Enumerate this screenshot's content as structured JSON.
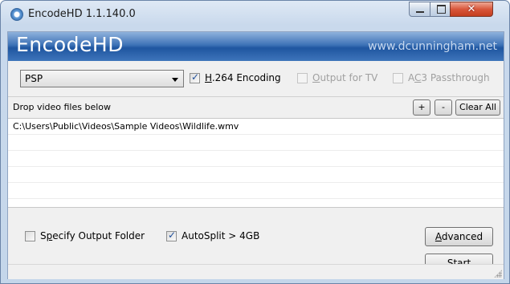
{
  "window": {
    "title": "EncodeHD 1.1.140.0",
    "controls": {
      "minimize": "minimize",
      "maximize": "maximize",
      "close": "close"
    }
  },
  "banner": {
    "app_name": "EncodeHD",
    "url": "www.dcunningham.net"
  },
  "options": {
    "device_select": {
      "selected": "PSP"
    },
    "h264": {
      "prefix": "H",
      "rest": ".264 Encoding",
      "checked": true,
      "enabled": true
    },
    "output_tv": {
      "prefix": "O",
      "rest": "utput for TV",
      "checked": false,
      "enabled": false
    },
    "ac3": {
      "pre": "A",
      "mnemonic": "C",
      "rest": "3 Passthrough",
      "checked": false,
      "enabled": false
    }
  },
  "drop": {
    "header_text": "Drop video files below",
    "add_label": "+",
    "remove_label": "-",
    "clear_label": "Clear All",
    "files": [
      "C:\\Users\\Public\\Videos\\Sample Videos\\Wildlife.wmv"
    ]
  },
  "bottom": {
    "specify_folder": {
      "pre": "S",
      "mnemonic": "p",
      "rest": "ecify Output Folder",
      "checked": false
    },
    "autosplit": {
      "label": "AutoSplit > 4GB",
      "checked": true
    },
    "advanced": {
      "mnemonic": "A",
      "rest": "dvanced"
    },
    "start": {
      "mnemonic": "S",
      "rest": "tart"
    }
  },
  "colors": {
    "banner_top": "#8fb2dc",
    "banner_bottom": "#1f56a0",
    "close_red": "#d8573b",
    "checkmark": "#1f4f9a"
  }
}
